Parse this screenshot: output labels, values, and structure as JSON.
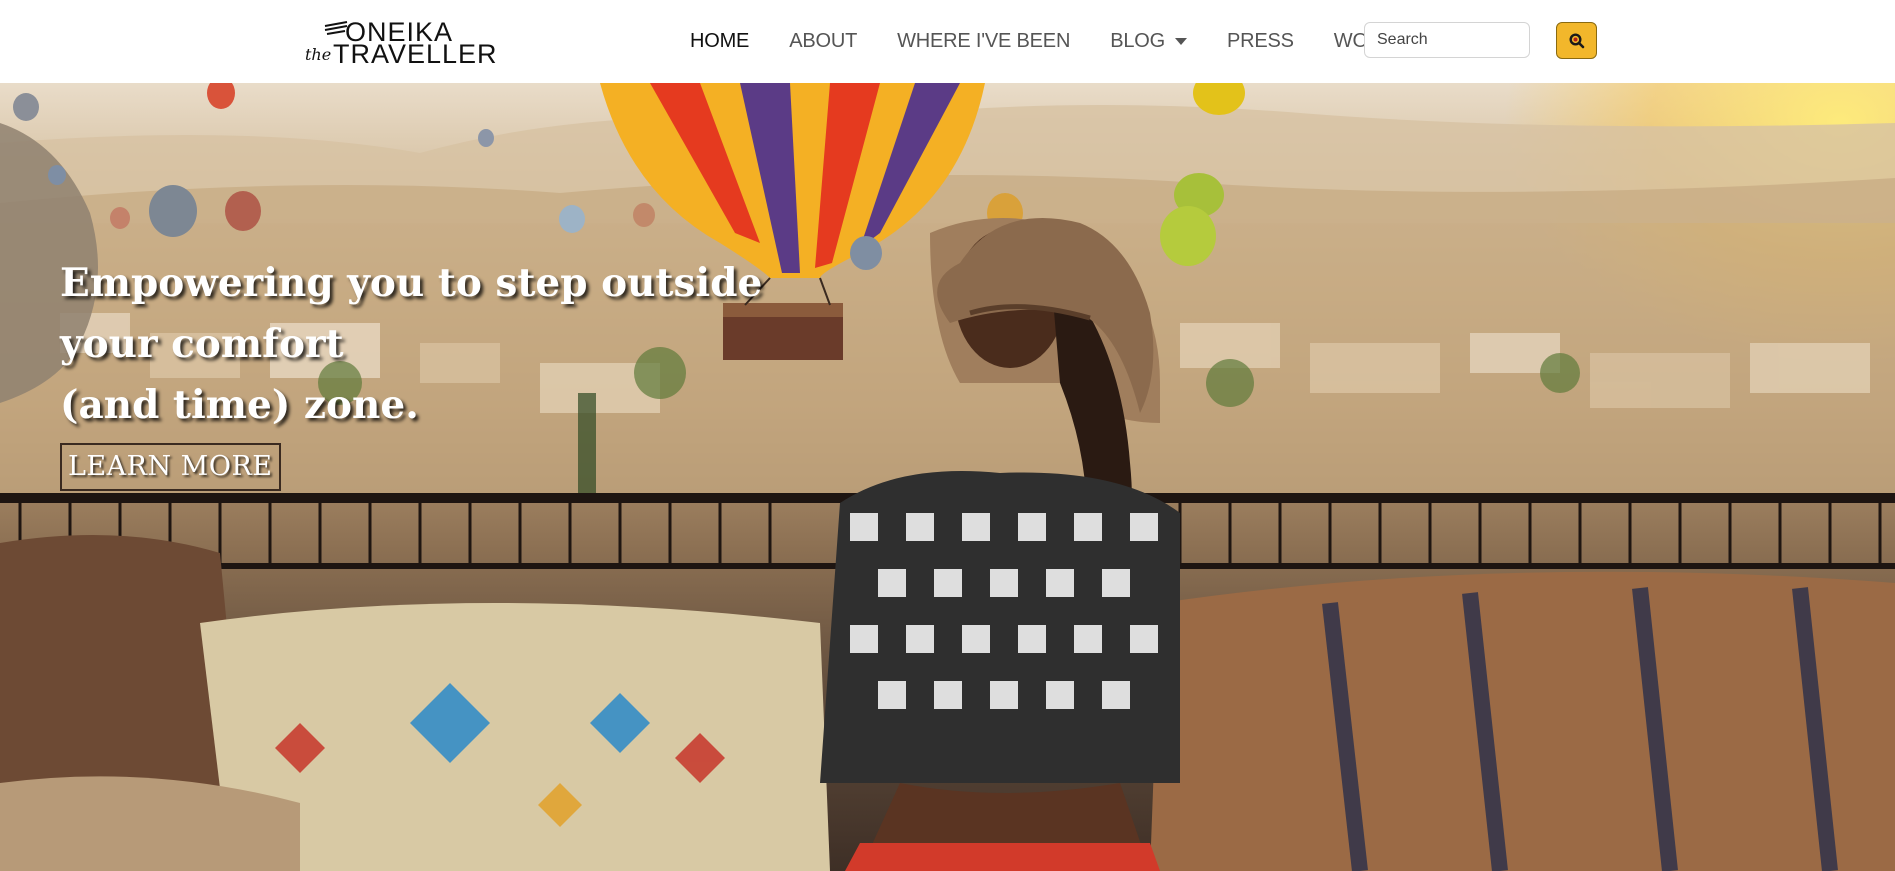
{
  "brand": {
    "logo_line1": "ONEIKA",
    "logo_line2": "TRAVELLER",
    "logo_the": "the",
    "accent_color": "#f2b72b"
  },
  "nav": {
    "items": [
      {
        "label": "HOME",
        "active": true
      },
      {
        "label": "ABOUT",
        "active": false
      },
      {
        "label": "WHERE I'VE BEEN",
        "active": false
      },
      {
        "label": "BLOG",
        "active": false,
        "dropdown": true
      },
      {
        "label": "PRESS",
        "active": false
      },
      {
        "label": "WORK WITH ME",
        "active": false
      }
    ]
  },
  "search": {
    "placeholder": "Search",
    "button_icon": "search-icon"
  },
  "hero": {
    "headline_line1": "Empowering you to step outside",
    "headline_line2": "your comfort",
    "headline_line3": "(and time) zone.",
    "cta_label": "LEARN MORE"
  }
}
